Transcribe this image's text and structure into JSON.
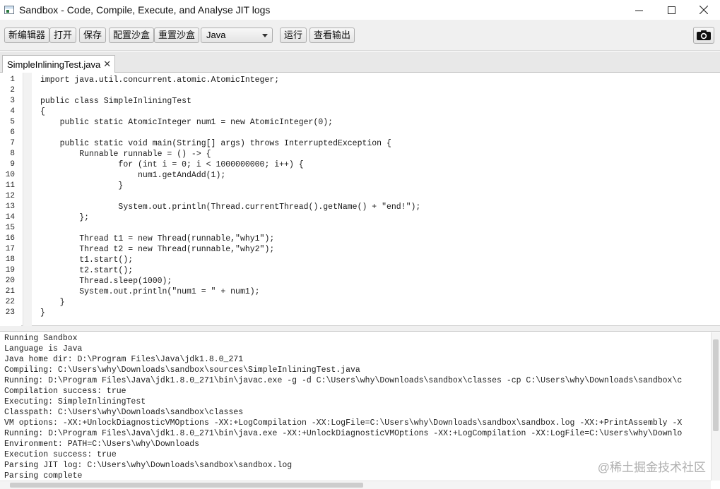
{
  "window": {
    "title": "Sandbox - Code, Compile, Execute, and Analyse JIT logs",
    "icon": "app-window-icon",
    "controls": [
      "minimize-icon",
      "maximize-icon",
      "close-icon"
    ]
  },
  "toolbar": {
    "new_editor": "新编辑器",
    "open": "打开",
    "save": "保存",
    "config_sandbox": "配置沙盒",
    "reset_sandbox": "重置沙盒",
    "language_selected": "Java",
    "run": "运行",
    "view_output": "查看输出",
    "screenshot_icon": "camera-icon"
  },
  "tabs": [
    {
      "label": "SimpleInliningTest.java",
      "close": "✕"
    }
  ],
  "editor": {
    "line_numbers": [
      "1",
      "2",
      "3",
      "4",
      "5",
      "6",
      "7",
      "8",
      "9",
      "10",
      "11",
      "12",
      "13",
      "14",
      "15",
      "16",
      "17",
      "18",
      "19",
      "20",
      "21",
      "22",
      "23"
    ],
    "lines": [
      "import java.util.concurrent.atomic.AtomicInteger;",
      "",
      "public class SimpleInliningTest",
      "{",
      "    public static AtomicInteger num1 = new AtomicInteger(0);",
      "",
      "    public static void main(String[] args) throws InterruptedException {",
      "        Runnable runnable = () -> {",
      "                for (int i = 0; i < 1000000000; i++) {",
      "                    num1.getAndAdd(1);",
      "                }",
      "",
      "                System.out.println(Thread.currentThread().getName() + \"end!\");",
      "        };",
      "",
      "        Thread t1 = new Thread(runnable,\"why1\");",
      "        Thread t2 = new Thread(runnable,\"why2\");",
      "        t1.start();",
      "        t2.start();",
      "        Thread.sleep(1000);",
      "        System.out.println(\"num1 = \" + num1);",
      "    }",
      "}"
    ]
  },
  "console": {
    "lines": [
      "Running Sandbox",
      "Language is Java",
      "Java home dir: D:\\Program Files\\Java\\jdk1.8.0_271",
      "Compiling: C:\\Users\\why\\Downloads\\sandbox\\sources\\SimpleInliningTest.java",
      "Running: D:\\Program Files\\Java\\jdk1.8.0_271\\bin\\javac.exe -g -d C:\\Users\\why\\Downloads\\sandbox\\classes -cp C:\\Users\\why\\Downloads\\sandbox\\c",
      "Compilation success: true",
      "Executing: SimpleInliningTest",
      "Classpath: C:\\Users\\why\\Downloads\\sandbox\\classes",
      "VM options: -XX:+UnlockDiagnosticVMOptions -XX:+LogCompilation -XX:LogFile=C:\\Users\\why\\Downloads\\sandbox\\sandbox.log -XX:+PrintAssembly -X",
      "Running: D:\\Program Files\\Java\\jdk1.8.0_271\\bin\\java.exe -XX:+UnlockDiagnosticVMOptions -XX:+LogCompilation -XX:LogFile=C:\\Users\\why\\Downlo",
      "Environment: PATH=C:\\Users\\why\\Downloads",
      "Execution success: true",
      "Parsing JIT log: C:\\Users\\why\\Downloads\\sandbox\\sandbox.log",
      "Parsing complete"
    ]
  },
  "watermark": "@稀土掘金技术社区"
}
